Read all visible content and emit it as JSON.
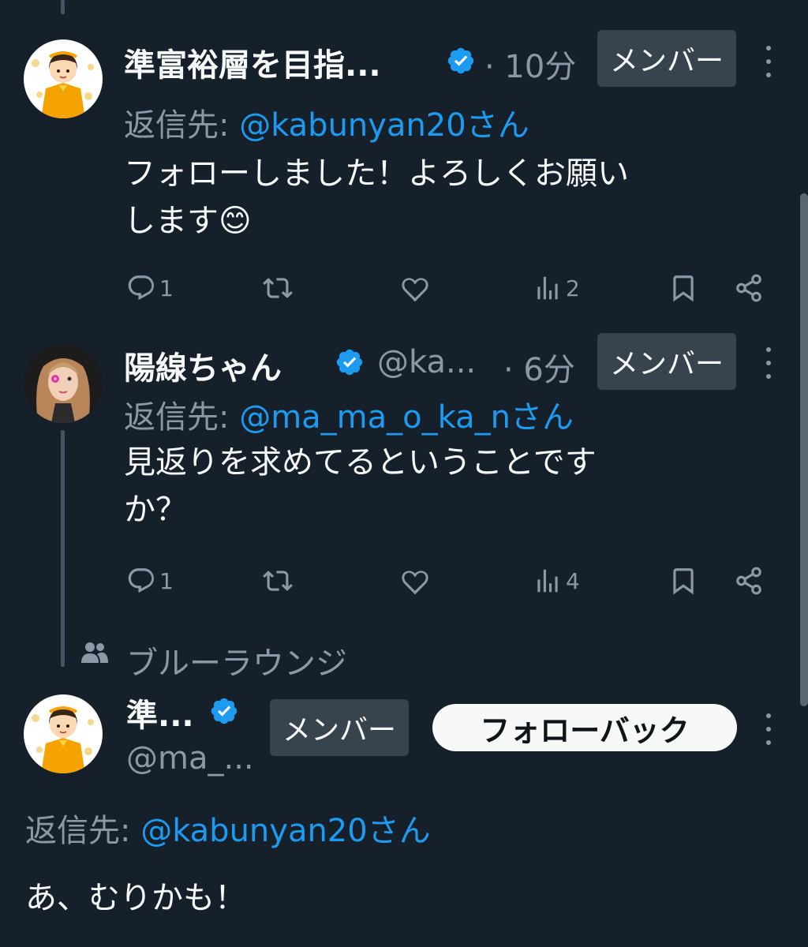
{
  "tweets": [
    {
      "display_name": "準富裕層を目指...",
      "time": "· 10分",
      "member_badge": "メンバー",
      "reply_label": "返信先:",
      "reply_mention": "@kabunyan20さん",
      "text_lines": [
        "フォローしました！よろしくお願い",
        "します😊"
      ],
      "actions": {
        "replies": "1",
        "retweets": "",
        "likes": "",
        "views": "2"
      }
    },
    {
      "display_name": "陽線ちゃん",
      "handle": "@ka...",
      "time": "· 6分",
      "member_badge": "メンバー",
      "reply_label": "返信先:",
      "reply_mention": "@ma_ma_o_ka_nさん",
      "text_lines": [
        "見返りを求めてるということです",
        "か？"
      ],
      "actions": {
        "replies": "1",
        "retweets": "",
        "likes": "",
        "views": "4"
      }
    },
    {
      "community": "ブルーラウンジ",
      "display_name": "準...",
      "handle": "@ma_...",
      "member_badge": "メンバー",
      "follow_back": "フォローバック",
      "reply_label": "返信先:",
      "reply_mention": "@kabunyan20さん",
      "text": "あ、むりかも！"
    }
  ],
  "icons": [
    "verified-badge-icon",
    "more-icon",
    "reply-icon",
    "retweet-icon",
    "like-icon",
    "views-icon",
    "bookmark-icon",
    "share-icon",
    "community-icon"
  ],
  "colors": {
    "background": "#15202b",
    "accent": "#1d9bf0",
    "muted": "#8b98a5",
    "badge": "#38444d"
  }
}
